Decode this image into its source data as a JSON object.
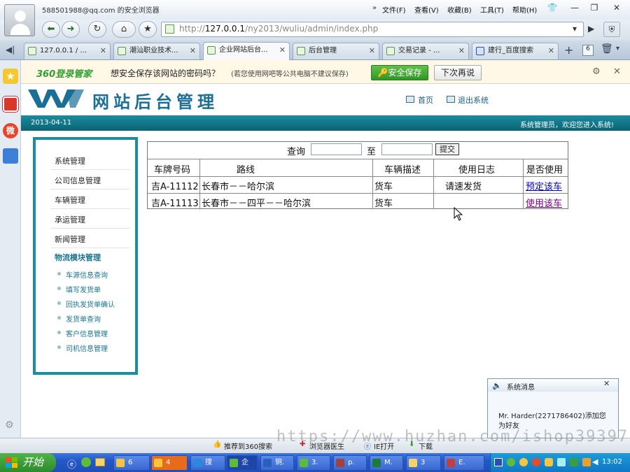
{
  "browser": {
    "account": "588501988@qq.com 的安全浏览器",
    "menu": [
      "文件(F)",
      "查看(V)",
      "收藏(B)",
      "工具(T)",
      "帮助(H)"
    ],
    "url_prefix": "http://",
    "url_host": "127.0.0.1",
    "url_path": "/ny2013/wuliu/admin/index.php",
    "tabs": [
      {
        "label": "127.0.0.1 / ..."
      },
      {
        "label": "潮汕职业技术..."
      },
      {
        "label": "企业网站后台..."
      },
      {
        "label": "后台管理"
      },
      {
        "label": "交易记录 - ..."
      },
      {
        "label": "建行_百度搜索"
      }
    ],
    "passwordbar": {
      "logo": "360登录管家",
      "message": "想安全保存该网站的密码吗？",
      "note": "(若您使用网吧等公共电脑不建议保存)",
      "save": "安全保存",
      "later": "下次再说"
    },
    "status": {
      "recommend": "推荐到360搜索",
      "doctor": "浏览器医生",
      "ie": "IE打开",
      "download": "下载"
    }
  },
  "site": {
    "title": "网站后台管理",
    "home_link": "首页",
    "logout_link": "退出系统",
    "date": "2013-04-11",
    "welcome": "系统管理员，欢迎您进入系统!"
  },
  "menu": {
    "items": [
      "系统管理",
      "公司信息管理",
      "车辆管理",
      "承运管理",
      "新闻管理"
    ],
    "section": "物流模块管理",
    "subitems": [
      "车源信息查询",
      "填写发货单",
      "回执发货单确认",
      "发货单查询",
      "客户信息管理",
      "司机信息管理"
    ]
  },
  "query": {
    "label": "查询",
    "to": "至",
    "submit": "提交"
  },
  "table": {
    "headers": [
      "车牌号码",
      "路线",
      "车辆描述",
      "使用日志",
      "是否使用"
    ],
    "rows": [
      [
        "吉A-11112",
        "长春市－－哈尔滨",
        "货车",
        "请速发货",
        "预定该车"
      ],
      [
        "吉A-11113",
        "长春市－－四平－－哈尔滨",
        "货车",
        "",
        "使用该车"
      ]
    ]
  },
  "popup": {
    "title": "系统消息",
    "message": "Mr. Harder(2271786402)添加您为好友"
  },
  "taskbar": {
    "start": "开始",
    "buttons": [
      "6",
      "4",
      "搜",
      "企",
      "铜.",
      "3.",
      "p.",
      "M.",
      "3",
      "E."
    ],
    "time": "13:02"
  },
  "watermark": "https://www.huzhan.com/ishop39397"
}
